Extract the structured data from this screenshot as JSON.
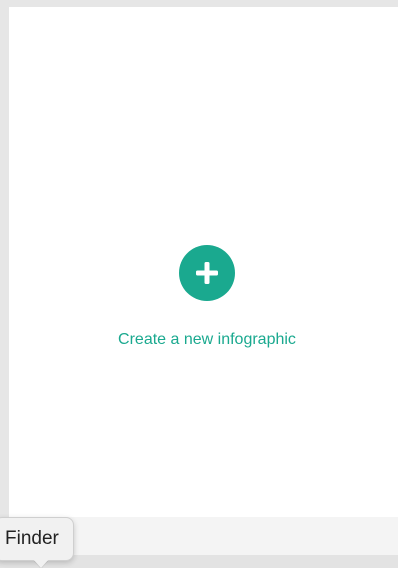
{
  "create_card": {
    "label": "Create a new infographic",
    "icon": "plus-icon",
    "accent_color": "#1aa98f"
  },
  "tooltip": {
    "text": "Finder"
  }
}
